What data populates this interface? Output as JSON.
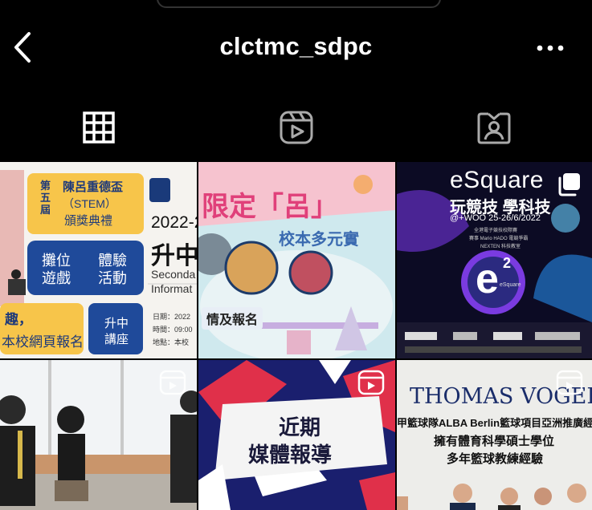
{
  "header": {
    "username": "clctmc_sdpc"
  },
  "tabs": [
    {
      "name": "posts-grid",
      "selected": true
    },
    {
      "name": "reels",
      "selected": false
    },
    {
      "name": "tagged",
      "selected": false
    }
  ],
  "posts": {
    "p1": {
      "award_prefix": "第五屆",
      "award_title": "陳呂重德盃",
      "award_stem": "（STEM）",
      "award_ceremony": "頒獎典禮",
      "booth_left": "攤位遊戲",
      "booth_right": "體驗活動",
      "year": "2022-2",
      "heading": "升中",
      "secondary": "Seconda",
      "informat": "Informat",
      "reg_line1": "趣，",
      "reg_line2": "本校網頁報名",
      "talk": "升中講座",
      "date_label": "日期：2022",
      "time_label": "時間：09:00",
      "place_label": "地點：本校"
    },
    "p2": {
      "banner": "限定「呂」",
      "subtitle": "校本多元實",
      "tag": "情及報名"
    },
    "p3": {
      "brand": "eSquare",
      "slogan": "玩競技 學科技",
      "dates": "@+WOO 25-26/6/2022",
      "small1": "全港電子競技校際賽",
      "small2": "賽事 Mario HADO 電競爭霸",
      "small3": "NEXTEN 科技教室",
      "logo_e": "e",
      "logo_sup": "2",
      "logo_caption": "eSquare"
    },
    "p4": {},
    "p5": {
      "title_line1": "近期",
      "title_line2": "媒體報導"
    },
    "p6": {
      "name": "THOMAS VOGEL",
      "line1": "甲籃球隊ALBA Berlin籃球項目亞洲推廣經",
      "line2": "擁有體育科學碩士學位",
      "line3": "多年籃球教練經驗"
    }
  }
}
